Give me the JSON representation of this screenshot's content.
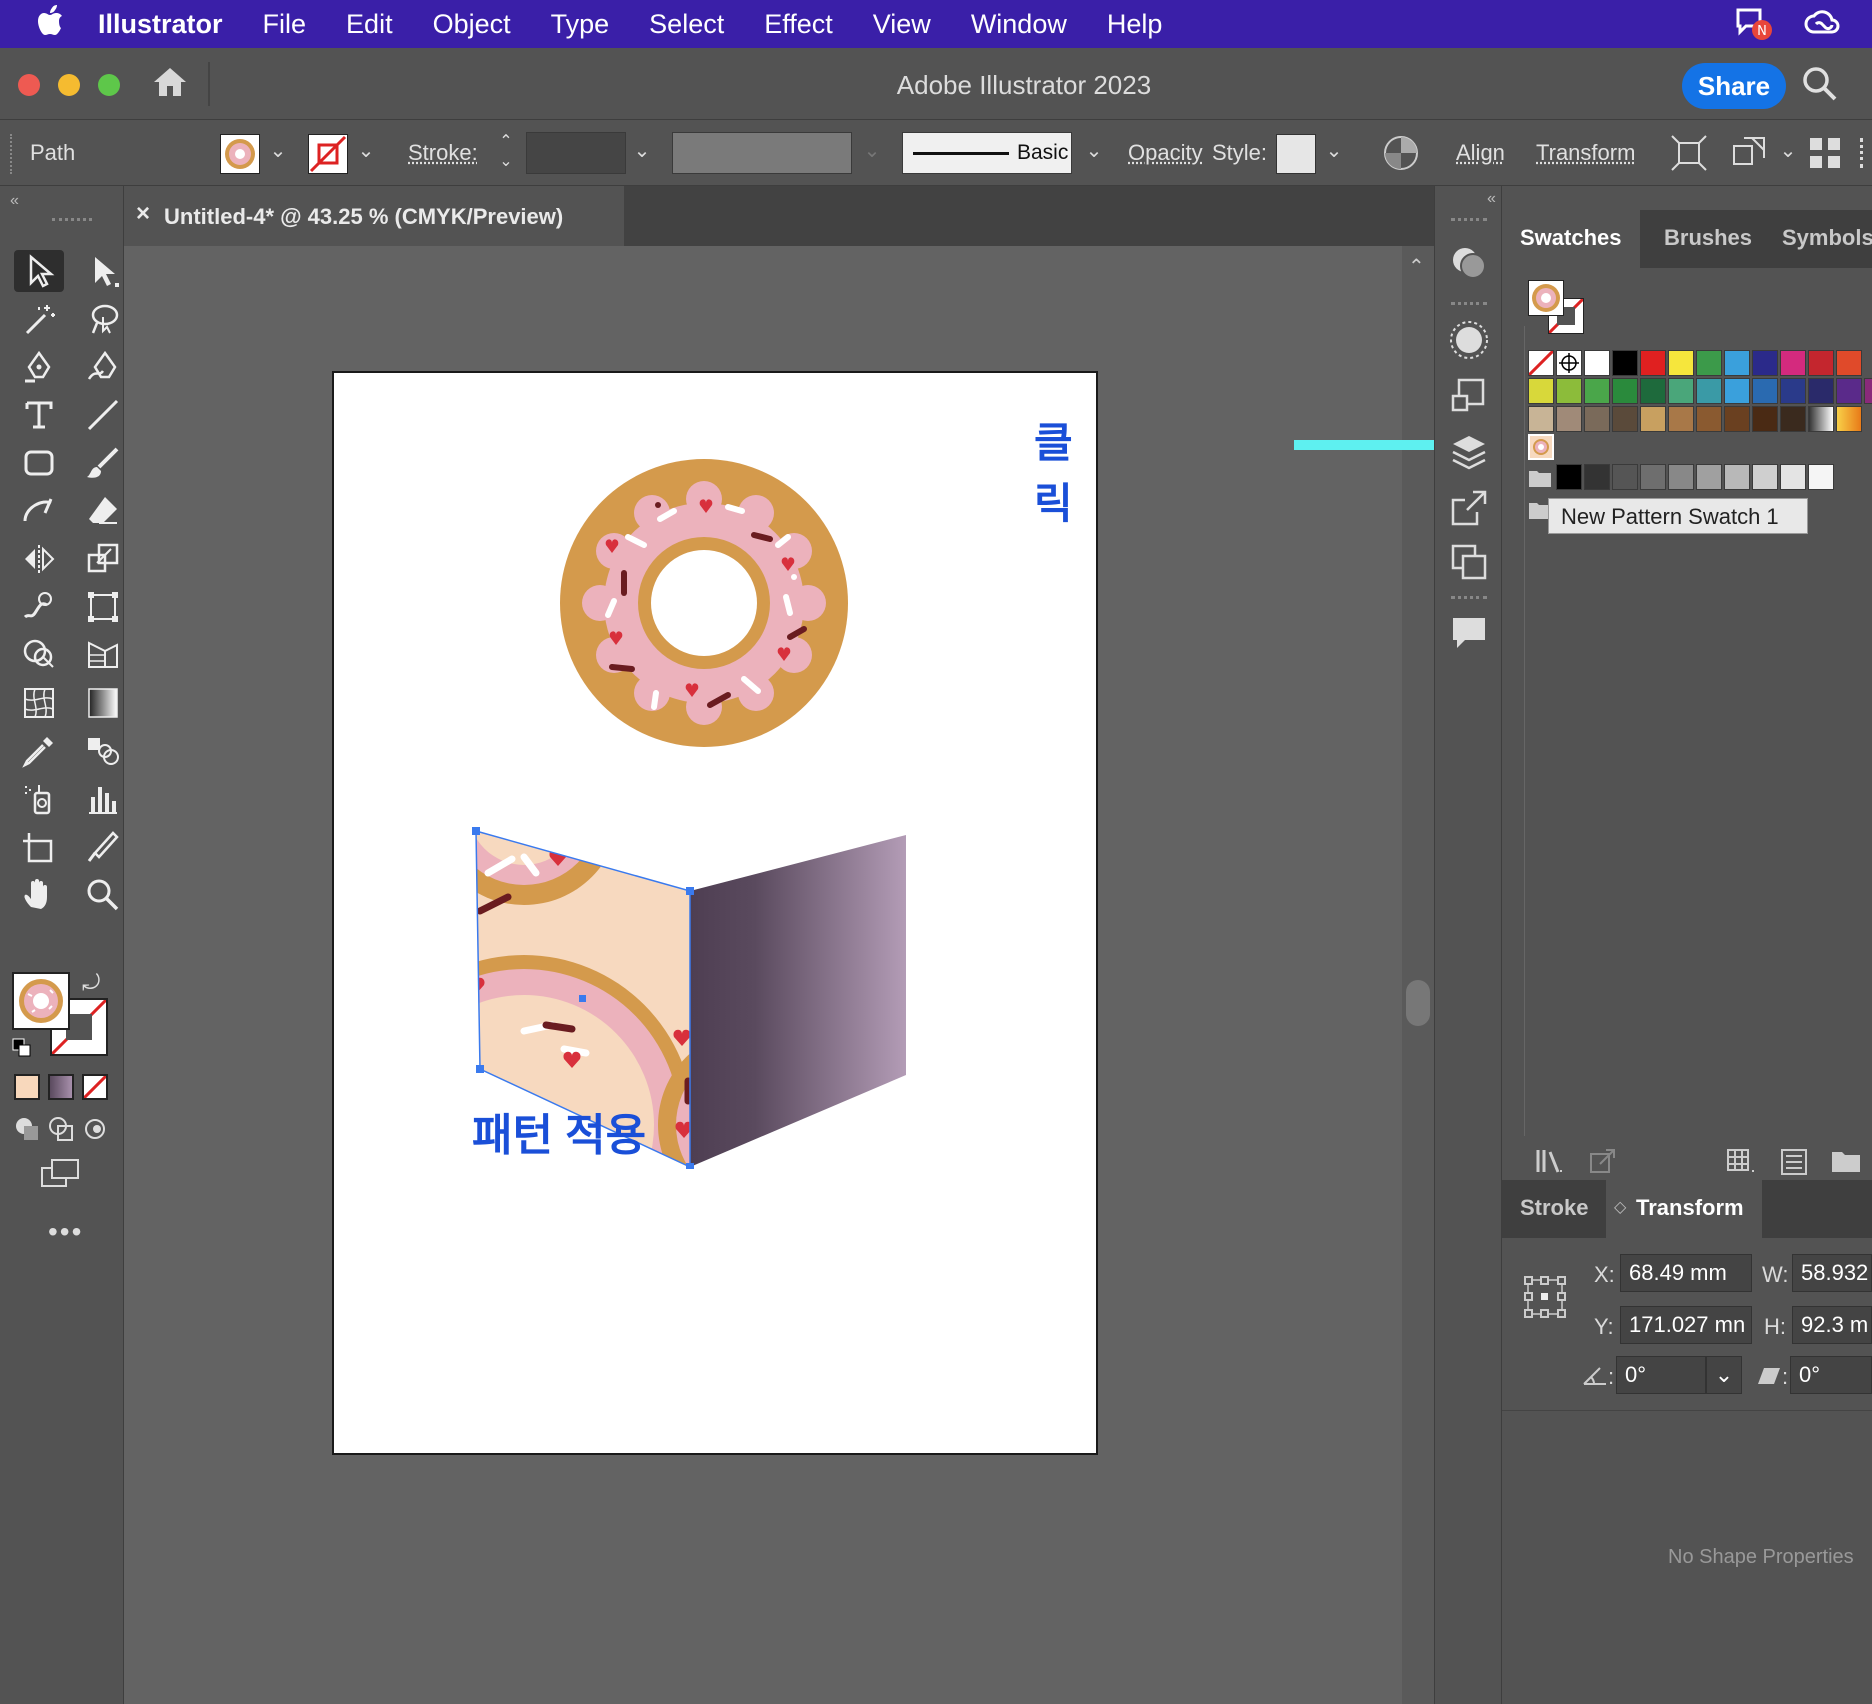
{
  "menubar": {
    "items": [
      "Illustrator",
      "File",
      "Edit",
      "Object",
      "Type",
      "Select",
      "Effect",
      "View",
      "Window",
      "Help"
    ]
  },
  "titlebar": {
    "title": "Adobe Illustrator 2023",
    "share_label": "Share"
  },
  "controlbar": {
    "selection_type": "Path",
    "stroke_label": "Stroke:",
    "brush_label": "Basic",
    "opacity_label": "Opacity",
    "style_label": "Style:",
    "align_label": "Align",
    "transform_label": "Transform"
  },
  "document": {
    "tab_title": "Untitled-4* @ 43.25 % (CMYK/Preview)",
    "close_glyph": "×"
  },
  "annotations": {
    "click_label": "클릭",
    "apply_label": "패턴 적용"
  },
  "swatches_panel": {
    "tabs": [
      "Swatches",
      "Brushes",
      "Symbols"
    ],
    "tooltip": "New Pattern Swatch 1",
    "row1": [
      "#ffffff",
      "#000000",
      "#e02020",
      "#f6e63c",
      "#3c9a4a",
      "#3aa0dc",
      "#2b2a8a",
      "#d42a7e",
      "#c4262e",
      "#e04a2a"
    ],
    "row2": [
      "#d8d83a",
      "#8cbc3a",
      "#4aa64a",
      "#2a8a3c",
      "#1e6a3c",
      "#4aa67a",
      "#3a9aa6",
      "#3aa0dc",
      "#2a6ab0",
      "#2a3a8a",
      "#2a2a6a",
      "#5a2a8a",
      "#8a2a7a"
    ],
    "row3": [
      "#c8b496",
      "#a08a78",
      "#7a6a5a",
      "#5a4a3a",
      "#c8a060",
      "#a87848",
      "#8a5a30",
      "#6a4020",
      "#4a2a14",
      "#3a2a1e"
    ],
    "grays": [
      "#000000",
      "#333333",
      "#555555",
      "#6e6e6e",
      "#888888",
      "#a0a0a0",
      "#b8b8b8",
      "#cfcfcf",
      "#e4e4e4",
      "#f5f5f5"
    ]
  },
  "transform_panel": {
    "tabs": [
      "Stroke",
      "Transform"
    ],
    "x_label": "X:",
    "x_value": "68.49 mm",
    "y_label": "Y:",
    "y_value": "171.027 mn",
    "w_label": "W:",
    "w_value": "58.932",
    "h_label": "H:",
    "h_value": "92.3 m",
    "angle_value": "0°",
    "shear_value": "0°",
    "angle_label": ":",
    "shear_label": ":",
    "no_shape": "No Shape Properties"
  },
  "colors": {
    "menubar_bg": "#3a1fa8",
    "accent_blue": "#1473e6",
    "annotation_blue": "#1a4fd8",
    "arrow_cyan": "#5ef0f0",
    "donut_dough": "#d49a4c",
    "donut_icing": "#ecb2bc",
    "heart_red": "#d8303c",
    "selection_blue": "#3a7aee"
  }
}
